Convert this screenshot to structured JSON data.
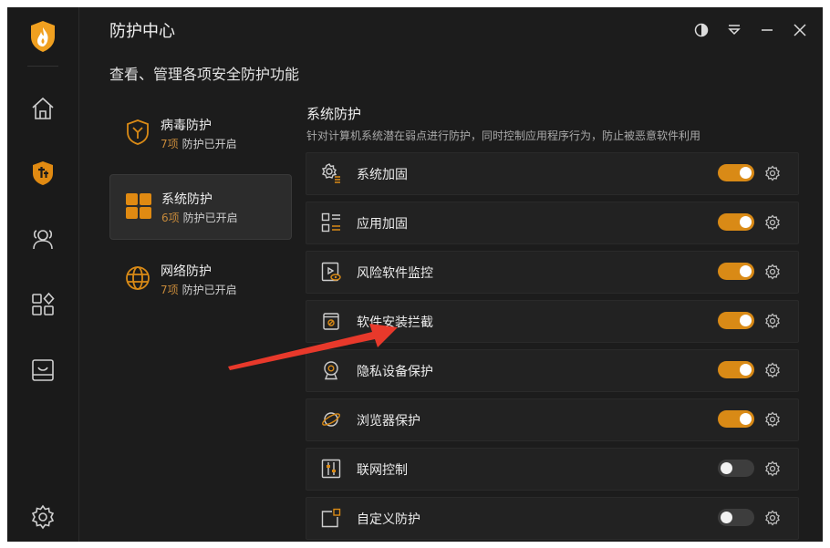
{
  "app": {
    "title": "防护中心",
    "subtitle": "查看、管理各项安全防护功能"
  },
  "rail": {
    "icons": [
      "flame-logo-icon",
      "home-icon",
      "protection-icon",
      "users-icon",
      "apps-icon",
      "toolbox-icon",
      "settings-icon"
    ]
  },
  "window_controls": [
    "theme-icon",
    "menu-icon",
    "minimize-icon",
    "close-icon"
  ],
  "categories": [
    {
      "name": "病毒防护",
      "count": "7项",
      "status": "防护已开启",
      "icon": "virus-shield-icon",
      "selected": false
    },
    {
      "name": "系统防护",
      "count": "6项",
      "status": "防护已开启",
      "icon": "system-grid-icon",
      "selected": true
    },
    {
      "name": "网络防护",
      "count": "7项",
      "status": "防护已开启",
      "icon": "globe-icon",
      "selected": false
    }
  ],
  "section": {
    "title": "系统防护",
    "description": "针对计算机系统潜在弱点进行防护，同时控制应用程序行为，防止被恶意软件利用"
  },
  "items": [
    {
      "name": "系统加固",
      "icon": "gear-list-icon",
      "enabled": true
    },
    {
      "name": "应用加固",
      "icon": "app-list-icon",
      "enabled": true
    },
    {
      "name": "风险软件监控",
      "icon": "monitor-eye-icon",
      "enabled": true
    },
    {
      "name": "软件安装拦截",
      "icon": "install-block-icon",
      "enabled": true
    },
    {
      "name": "隐私设备保护",
      "icon": "webcam-icon",
      "enabled": true
    },
    {
      "name": "浏览器保护",
      "icon": "planet-icon",
      "enabled": true
    },
    {
      "name": "联网控制",
      "icon": "network-control-icon",
      "enabled": false
    },
    {
      "name": "自定义防护",
      "icon": "custom-square-icon",
      "enabled": false
    }
  ],
  "colors": {
    "accent": "#d98a16",
    "background": "#1c1c1c",
    "count_text": "#c6893a",
    "annotation_arrow": "#e8392b"
  }
}
